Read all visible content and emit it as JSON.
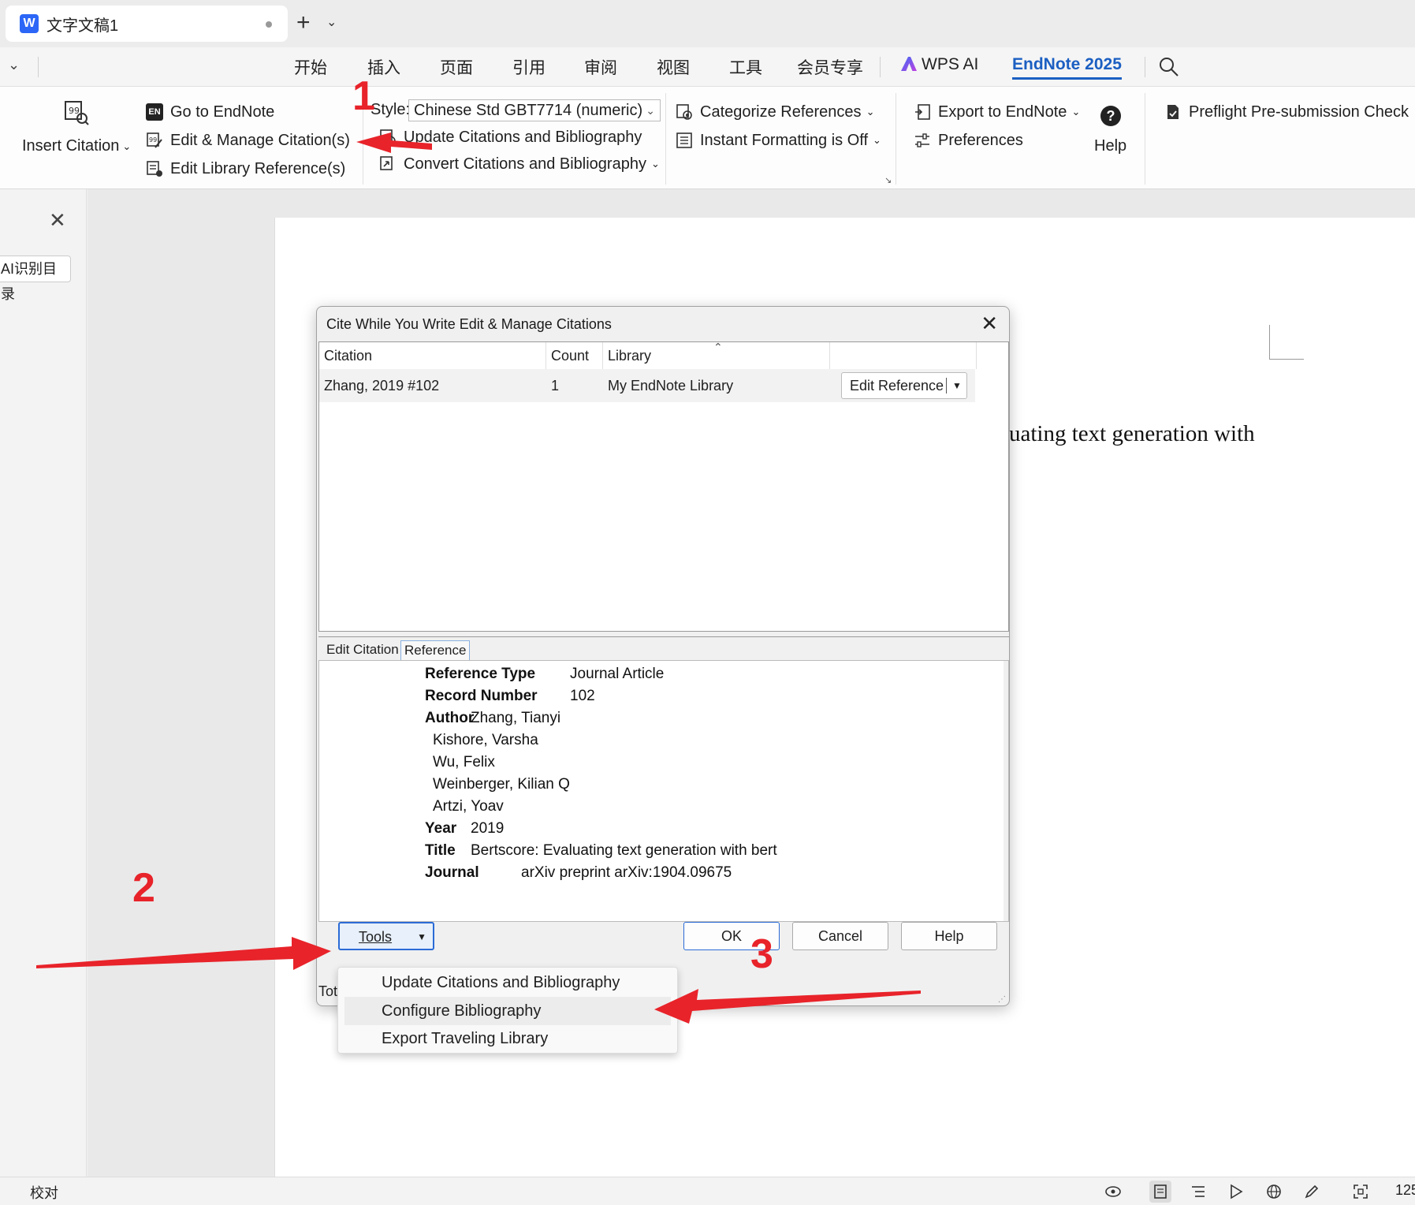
{
  "tab": {
    "doc_title": "文字文稿1",
    "new_tab": "+",
    "dd": "⌄"
  },
  "menu": {
    "items": [
      "开始",
      "插入",
      "页面",
      "引用",
      "审阅",
      "视图",
      "工具",
      "会员专享"
    ],
    "wps_ai": "WPS AI",
    "endnote": "EndNote 2025"
  },
  "ribbon": {
    "insert_citation": "Insert Citation",
    "go_to_endnote": "Go to EndNote",
    "edit_manage": "Edit & Manage Citation(s)",
    "edit_library": "Edit Library Reference(s)",
    "style_label": "Style:",
    "style_value": "Chinese Std GBT7714 (numeric)",
    "update": "Update Citations and Bibliography",
    "convert": "Convert Citations and Bibliography",
    "categorize": "Categorize References",
    "instant_formatting": "Instant Formatting is Off",
    "export": "Export to EndNote",
    "preferences": "Preferences",
    "help": "Help",
    "preflight": "Preflight Pre-submission Check",
    "en_badge": "EN"
  },
  "left_pane": {
    "ai_button": "AI识别目录"
  },
  "page": {
    "text": "uating text generation with"
  },
  "dialog": {
    "title": "Cite While You Write Edit & Manage Citations",
    "columns": [
      "Citation",
      "Count",
      "Library"
    ],
    "rows": [
      {
        "citation": "Zhang, 2019 #102",
        "count": "1",
        "library": "My EndNote Library"
      }
    ],
    "edit_reference": "Edit Reference",
    "tabs": [
      "Edit Citation",
      "Reference"
    ],
    "reference": {
      "type_label": "Reference Type",
      "type_value": "Journal Article",
      "record_label": "Record Number",
      "record_value": "102",
      "author_label": "Author",
      "authors": [
        "Zhang, Tianyi",
        "Kishore, Varsha",
        "Wu, Felix",
        "Weinberger, Kilian Q",
        "Artzi, Yoav"
      ],
      "year_label": "Year",
      "year_value": "2019",
      "title_label": "Title",
      "title_value": "Bertscore: Evaluating text generation with bert",
      "journal_label": "Journal",
      "journal_value": "arXiv preprint arXiv:1904.09675"
    },
    "tools": "Tools",
    "ok": "OK",
    "cancel": "Cancel",
    "help": "Help",
    "total": "Tot"
  },
  "tools_menu": [
    "Update Citations and Bibliography",
    "Configure Bibliography",
    "Export Traveling Library"
  ],
  "annotations": [
    "1",
    "2",
    "3"
  ],
  "status": {
    "left": "校对",
    "zoom": "125"
  },
  "colors": {
    "accent": "#1b5fc2",
    "annotation": "#e8232a",
    "word_blue": "#2b66f6"
  }
}
